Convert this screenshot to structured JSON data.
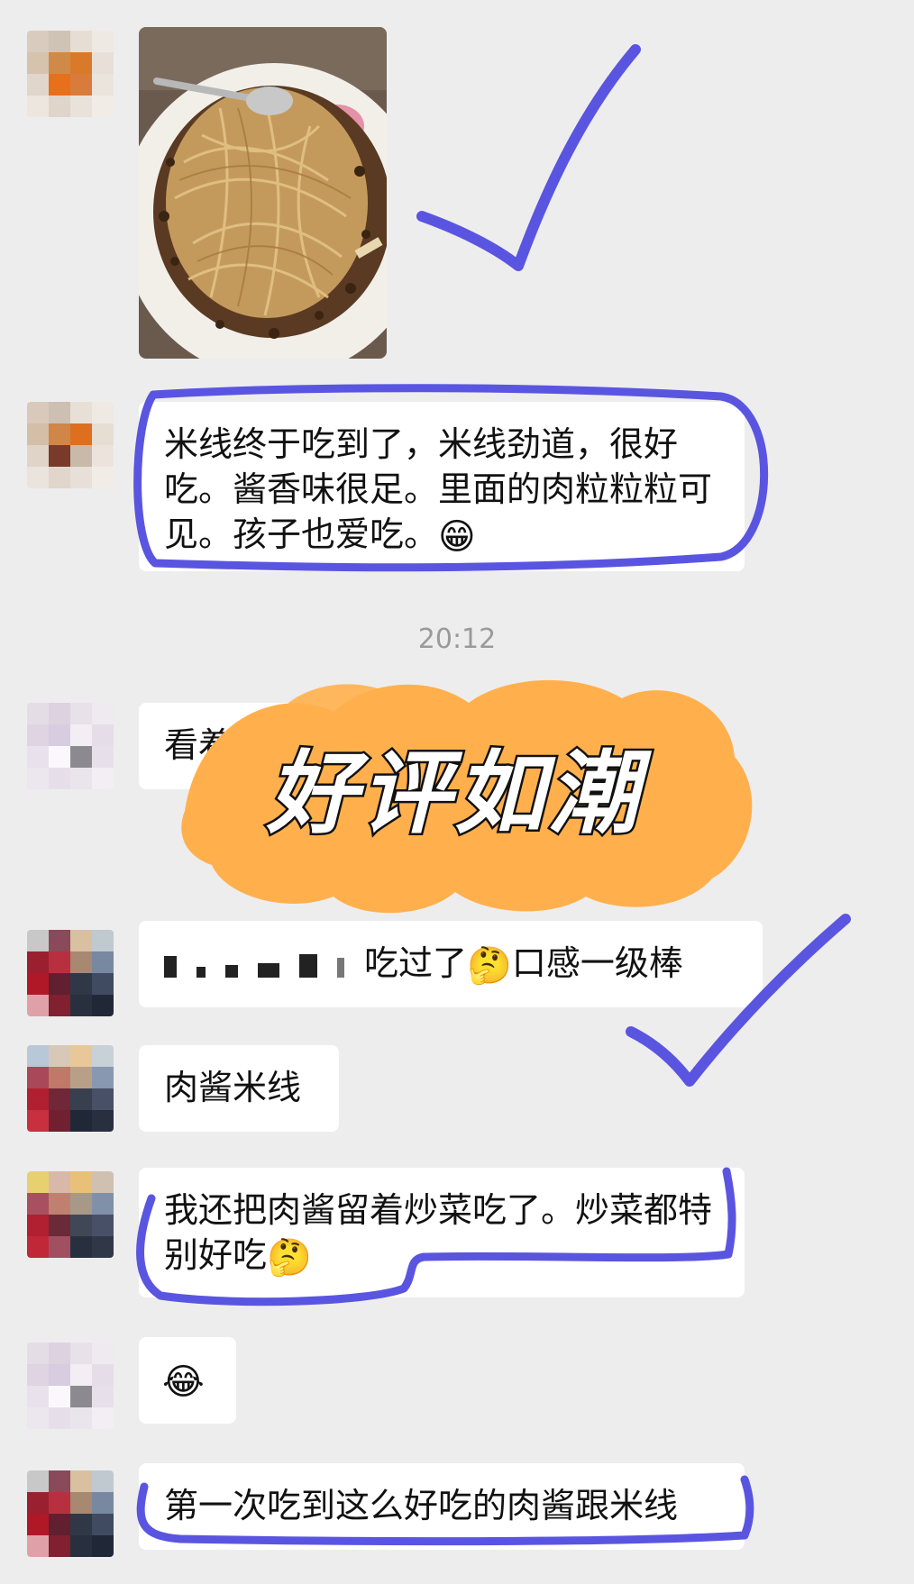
{
  "messages": [
    {
      "id": "msg1",
      "type": "image",
      "alt": ""
    },
    {
      "id": "msg2",
      "text": "米线终于吃到了，米线劲道，很好吃。酱香味很足。里面的肉粒粒粒可见。孩子也爱吃。",
      "emoji": "😁"
    },
    {
      "id": "msg3",
      "text": "看着"
    },
    {
      "id": "msg4",
      "text": "吃过了",
      "emoji": "🤔",
      "text_after": "口感一级棒"
    },
    {
      "id": "msg5",
      "text": "肉酱米线"
    },
    {
      "id": "msg6",
      "text": "我还把肉酱留着炒菜吃了。炒菜都特别好吃",
      "emoji": "🤔"
    },
    {
      "id": "msg7",
      "emoji": "😂"
    },
    {
      "id": "msg8",
      "text": "第一次吃到这么好吃的肉酱跟米线"
    }
  ],
  "timestamp": "20:12",
  "overlay": {
    "badge_text": "好评如潮"
  },
  "colors": {
    "annotation_ink": "#5a55e0",
    "badge_orange": "#ffb04d",
    "chat_bg": "#ededed",
    "bubble_bg": "#ffffff"
  }
}
